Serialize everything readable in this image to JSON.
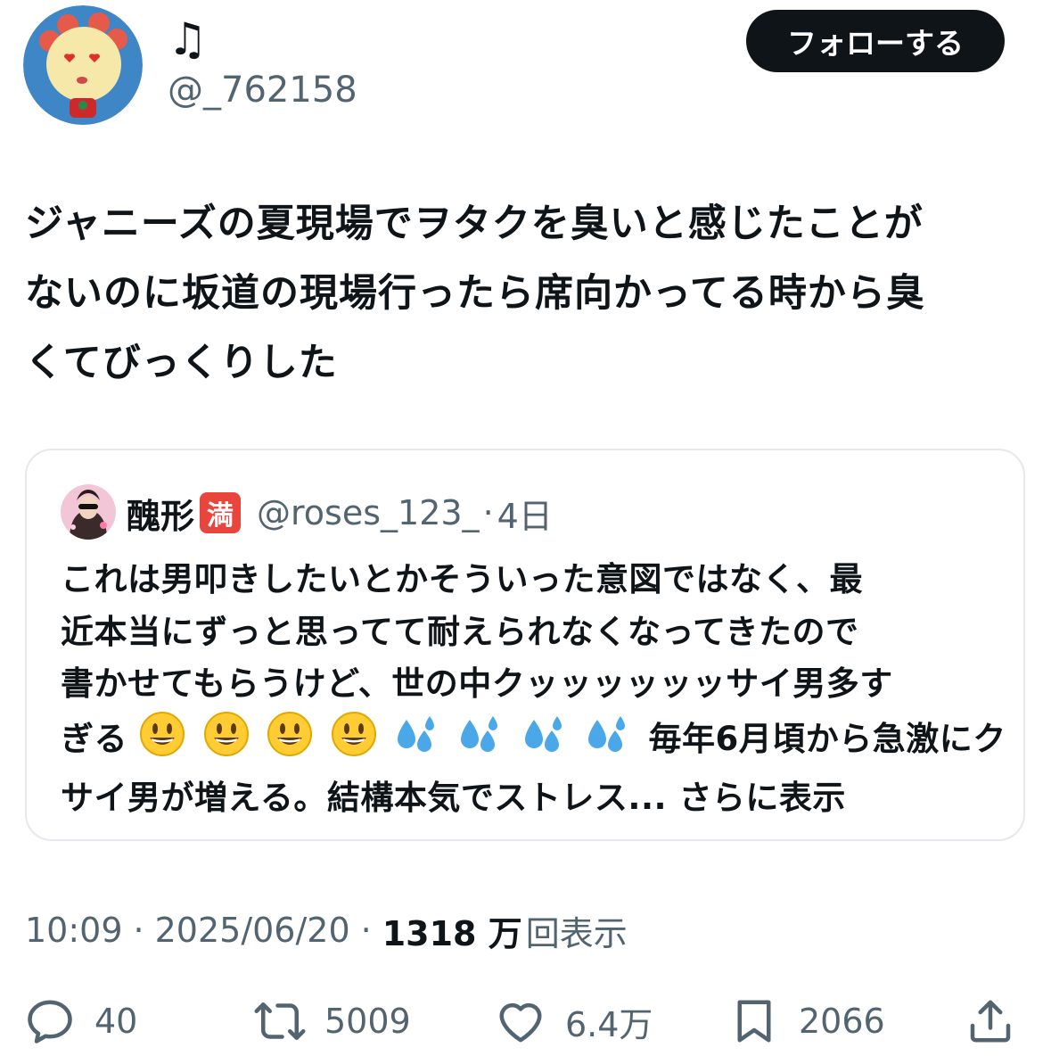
{
  "author": {
    "display_name": "♫",
    "handle": "@_762158",
    "follow_label": "フォローする"
  },
  "tweet": {
    "text_lines": [
      "ジャニーズの夏現場でヲタクを臭いと感じたことが",
      "ないのに坂道の現場行ったら席向かってる時から臭",
      "くてびっくりした"
    ]
  },
  "quote": {
    "name": "醜形",
    "badge": "満",
    "handle": "@roses_123_",
    "separator": "·",
    "time": "4日",
    "lines": [
      "これは男叩きしたいとかそういった意図ではなく、最",
      "近本当にずっと思ってて耐えられなくなってきたので",
      "書かせてもらうけど、世の中クッッッッッッサイ男多す"
    ],
    "line4_prefix": "ぎる",
    "line4_suffix": "毎年6月頃から急激にク",
    "line5": "サイ男が増える。結構本気でストレス... ",
    "show_more": "さらに表示"
  },
  "meta": {
    "time": "10:09",
    "dot1": "·",
    "date": "2025/06/20",
    "dot2": "·",
    "views_count": "1318 万",
    "views_label": "回表示"
  },
  "actions": {
    "replies": "40",
    "retweets": "5009",
    "likes": "6.4万",
    "bookmarks": "2066"
  },
  "icons": {
    "reply": "reply-icon",
    "retweet": "retweet-icon",
    "like": "heart-icon",
    "bookmark": "bookmark-icon",
    "share": "share-icon",
    "grin": "grinning-face-icon",
    "sweat": "sweat-droplets-icon"
  },
  "colors": {
    "text": "#0f1419",
    "secondary": "#536471",
    "follow_bg": "#0f1419",
    "avatar_bg": "#3f86c7",
    "badge": "#e8453c"
  }
}
